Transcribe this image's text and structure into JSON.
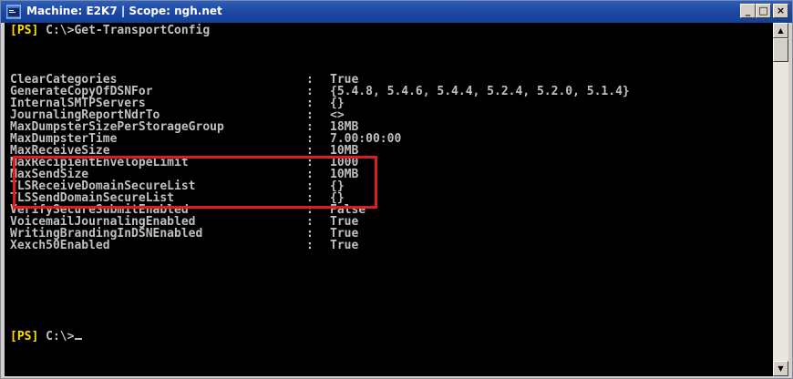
{
  "window": {
    "title": "Machine: E2K7 | Scope: ngh.net",
    "controls": {
      "minimize": "_",
      "maximize": "□",
      "close": "×"
    }
  },
  "console": {
    "prompt_tag": "[PS]",
    "command_prompt": " C:\\>Get-TransportConfig",
    "properties": [
      {
        "name": "ClearCategories",
        "sep": ":",
        "value": "True"
      },
      {
        "name": "GenerateCopyOfDSNFor",
        "sep": ":",
        "value": "{5.4.8, 5.4.6, 5.4.4, 5.2.4, 5.2.0, 5.1.4}"
      },
      {
        "name": "InternalSMTPServers",
        "sep": ":",
        "value": "{}"
      },
      {
        "name": "JournalingReportNdrTo",
        "sep": ":",
        "value": "<>"
      },
      {
        "name": "MaxDumpsterSizePerStorageGroup",
        "sep": ":",
        "value": "18MB"
      },
      {
        "name": "MaxDumpsterTime",
        "sep": ":",
        "value": "7.00:00:00"
      },
      {
        "name": "MaxReceiveSize",
        "sep": ":",
        "value": "10MB"
      },
      {
        "name": "MaxRecipientEnvelopeLimit",
        "sep": ":",
        "value": "1000"
      },
      {
        "name": "MaxSendSize",
        "sep": ":",
        "value": "10MB"
      },
      {
        "name": "TLSReceiveDomainSecureList",
        "sep": ":",
        "value": "{}"
      },
      {
        "name": "TLSSendDomainSecureList",
        "sep": ":",
        "value": "{}"
      },
      {
        "name": "VerifySecureSubmitEnabled",
        "sep": ":",
        "value": "False"
      },
      {
        "name": "VoicemailJournalingEnabled",
        "sep": ":",
        "value": "True"
      },
      {
        "name": "WritingBrandingInDSNEnabled",
        "sep": ":",
        "value": "True"
      },
      {
        "name": "Xexch50Enabled",
        "sep": ":",
        "value": "True"
      }
    ],
    "final_prompt_tag": "[PS]",
    "final_prompt": " C:\\>"
  },
  "colors": {
    "console_bg": "#000000",
    "console_text": "#c0c0c0",
    "prompt_tag": "#ffe000",
    "highlight": "#e01b1b",
    "titlebar": "#1d49a4"
  },
  "scrollbar": {
    "up_icon": "▲",
    "down_icon": "▼"
  }
}
